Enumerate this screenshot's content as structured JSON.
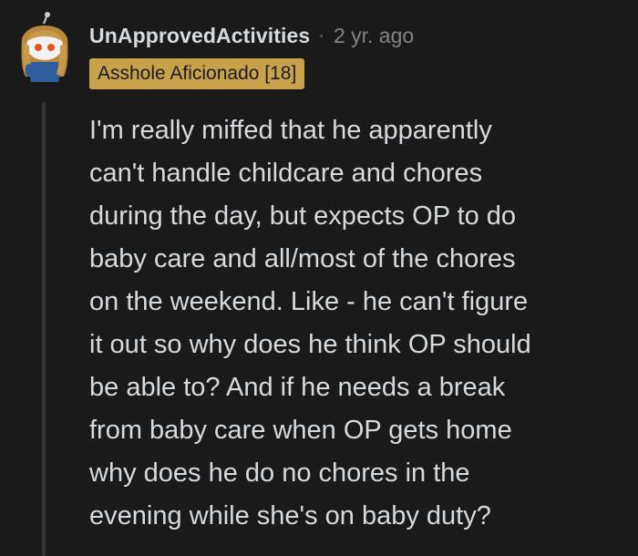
{
  "comment": {
    "username": "UnApprovedActivities",
    "separator": "·",
    "timestamp": "2 yr. ago",
    "flair": "Asshole Aficionado [18]",
    "body_lines": [
      "I'm really miffed that he apparently",
      "can't handle childcare and chores",
      "during the day, but expects OP to do",
      "baby care and all/most of the chores",
      "on the weekend. Like - he can't figure",
      "it out so why does he think OP should",
      "be able to? And if he needs a break",
      "from baby care when OP gets home",
      "why does he do no chores in the",
      "evening while she's on baby duty?"
    ]
  },
  "colors": {
    "background": "#1a1a1b",
    "text": "#d7dadc",
    "meta": "#818384",
    "flair_bg": "#c8a24a",
    "thread_line": "#343536"
  },
  "icons": {
    "avatar": "snoo-avatar-icon"
  }
}
